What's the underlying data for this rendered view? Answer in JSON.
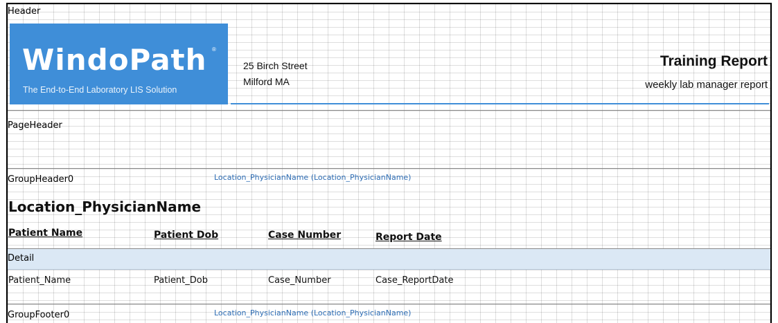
{
  "bands": {
    "header": "Header",
    "page_header": "PageHeader",
    "group_header": "GroupHeader0",
    "detail": "Detail",
    "group_footer": "GroupFooter0"
  },
  "logo": {
    "name": "WindoPath",
    "trademark": "®",
    "tagline": "The End-to-End Laboratory LIS Solution"
  },
  "address": {
    "line1": "25 Birch Street",
    "line2": "Milford MA"
  },
  "report": {
    "title": "Training Report",
    "subtitle": "weekly lab manager report"
  },
  "group": {
    "header_binding": "Location_PhysicianName (Location_PhysicianName)",
    "title_field": "Location_PhysicianName",
    "footer_binding": "Location_PhysicianName (Location_PhysicianName)"
  },
  "columns": {
    "headers": [
      "Patient Name",
      "Patient Dob",
      "Case Number",
      "Report Date"
    ],
    "fields": [
      "Patient_Name",
      "Patient_Dob",
      "Case_Number",
      "Case_ReportDate"
    ]
  },
  "colors": {
    "logo_background": "#3f8ed8",
    "accent_line": "#3f8ed8",
    "band_selected": "#dbe8f5",
    "binding_text": "#2d6db5"
  }
}
